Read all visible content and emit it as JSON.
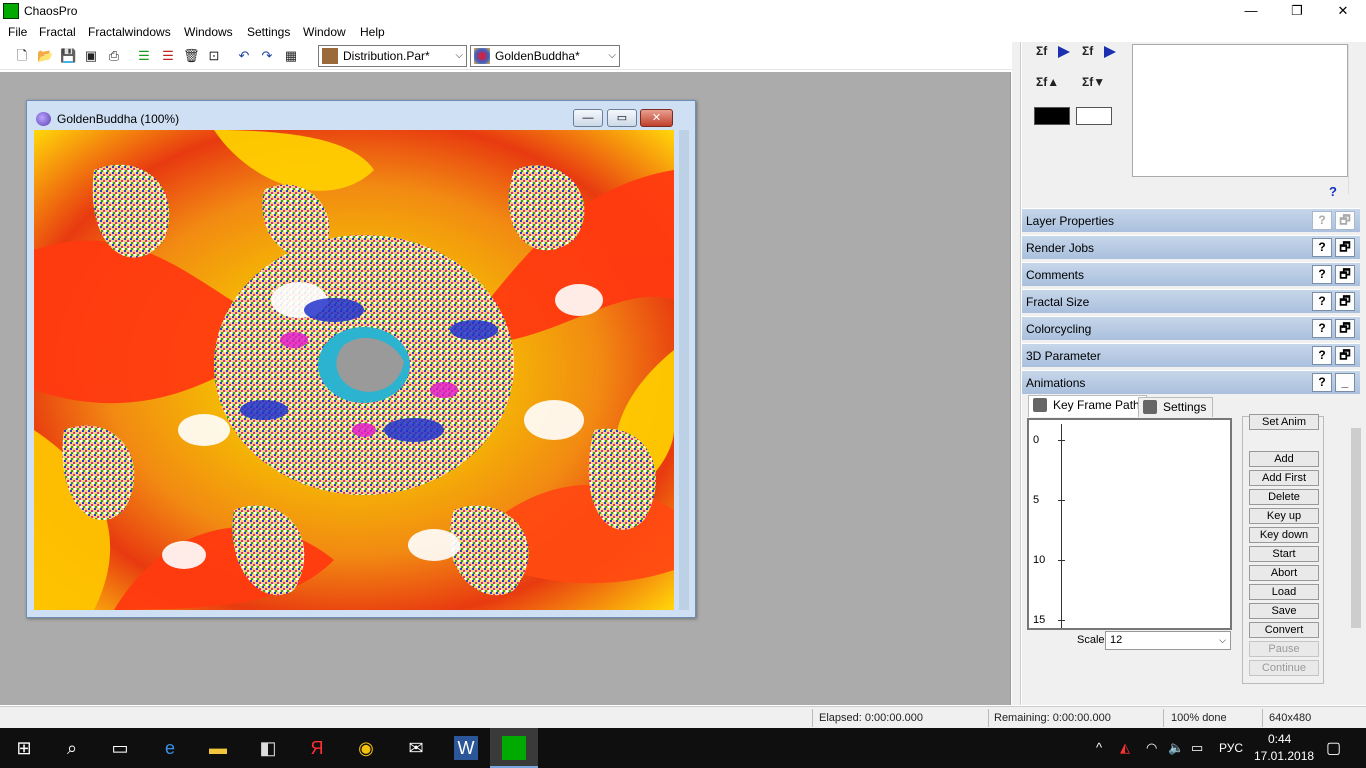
{
  "window": {
    "title": "ChaosPro",
    "minimize": "—",
    "maximize": "❐",
    "close": "✕"
  },
  "menu": [
    "File",
    "Fractal",
    "Fractalwindows",
    "Windows",
    "Settings",
    "Window",
    "Help"
  ],
  "toolbar": {
    "icons": [
      "new-icon",
      "open-icon",
      "save-icon",
      "save-all-icon",
      "print-icon",
      "layers-green-icon",
      "layers-red-icon",
      "delete-icon",
      "window-icon",
      "undo-icon",
      "redo-icon",
      "film-icon"
    ],
    "distribution_combo": "Distribution.Par*",
    "formula_combo": "GoldenBuddha*"
  },
  "fractal_window": {
    "title": "GoldenBuddha (100%)",
    "minimize": "—",
    "restore": "▭",
    "close": "✕"
  },
  "right_panel": {
    "help_mark": "?",
    "swatches": {
      "left": "#000000",
      "right": "#ffffff"
    },
    "sections": [
      {
        "label": "Layer Properties",
        "help": "?",
        "action": "🗗",
        "dim": true
      },
      {
        "label": "Render Jobs",
        "help": "?",
        "action": "🗗",
        "dim": false
      },
      {
        "label": "Comments",
        "help": "?",
        "action": "🗗",
        "dim": false
      },
      {
        "label": "Fractal Size",
        "help": "?",
        "action": "🗗",
        "dim": false
      },
      {
        "label": "Colorcycling",
        "help": "?",
        "action": "🗗",
        "dim": false
      },
      {
        "label": "3D Parameter",
        "help": "?",
        "action": "🗗",
        "dim": false
      },
      {
        "label": "Animations",
        "help": "?",
        "action": "_",
        "dim": false
      }
    ]
  },
  "animations": {
    "tabs": [
      "Key Frame Path",
      "Settings"
    ],
    "axis_labels": [
      "0",
      "5",
      "10",
      "15"
    ],
    "scale_label": "Scale",
    "scale_value": "12",
    "buttons": [
      {
        "label": "Set Anim",
        "disabled": false
      },
      {
        "label": "Add",
        "disabled": false
      },
      {
        "label": "Add First",
        "disabled": false
      },
      {
        "label": "Delete",
        "disabled": false
      },
      {
        "label": "Key up",
        "disabled": false
      },
      {
        "label": "Key down",
        "disabled": false
      },
      {
        "label": "Start",
        "disabled": false
      },
      {
        "label": "Abort",
        "disabled": false
      },
      {
        "label": "Load",
        "disabled": false
      },
      {
        "label": "Save",
        "disabled": false
      },
      {
        "label": "Convert",
        "disabled": false
      },
      {
        "label": "Pause",
        "disabled": true
      },
      {
        "label": "Continue",
        "disabled": true
      }
    ]
  },
  "status": {
    "elapsed": "Elapsed: 0:00:00.000",
    "remaining": "Remaining: 0:00:00.000",
    "progress": "100% done",
    "size": "640x480"
  },
  "taskbar": {
    "apps": [
      "start-icon",
      "search-icon",
      "task-view-icon",
      "edge-icon",
      "explorer-icon",
      "store-icon",
      "yandex-icon",
      "chrome-icon",
      "mail-icon",
      "word-icon",
      "chaospro-icon"
    ],
    "language": "РУС",
    "time": "0:44",
    "date": "17.01.2018"
  },
  "colors": {
    "mdi_background": "#ababab",
    "section_bar": "#a9c0dd",
    "taskbar": "#0f0f10"
  }
}
